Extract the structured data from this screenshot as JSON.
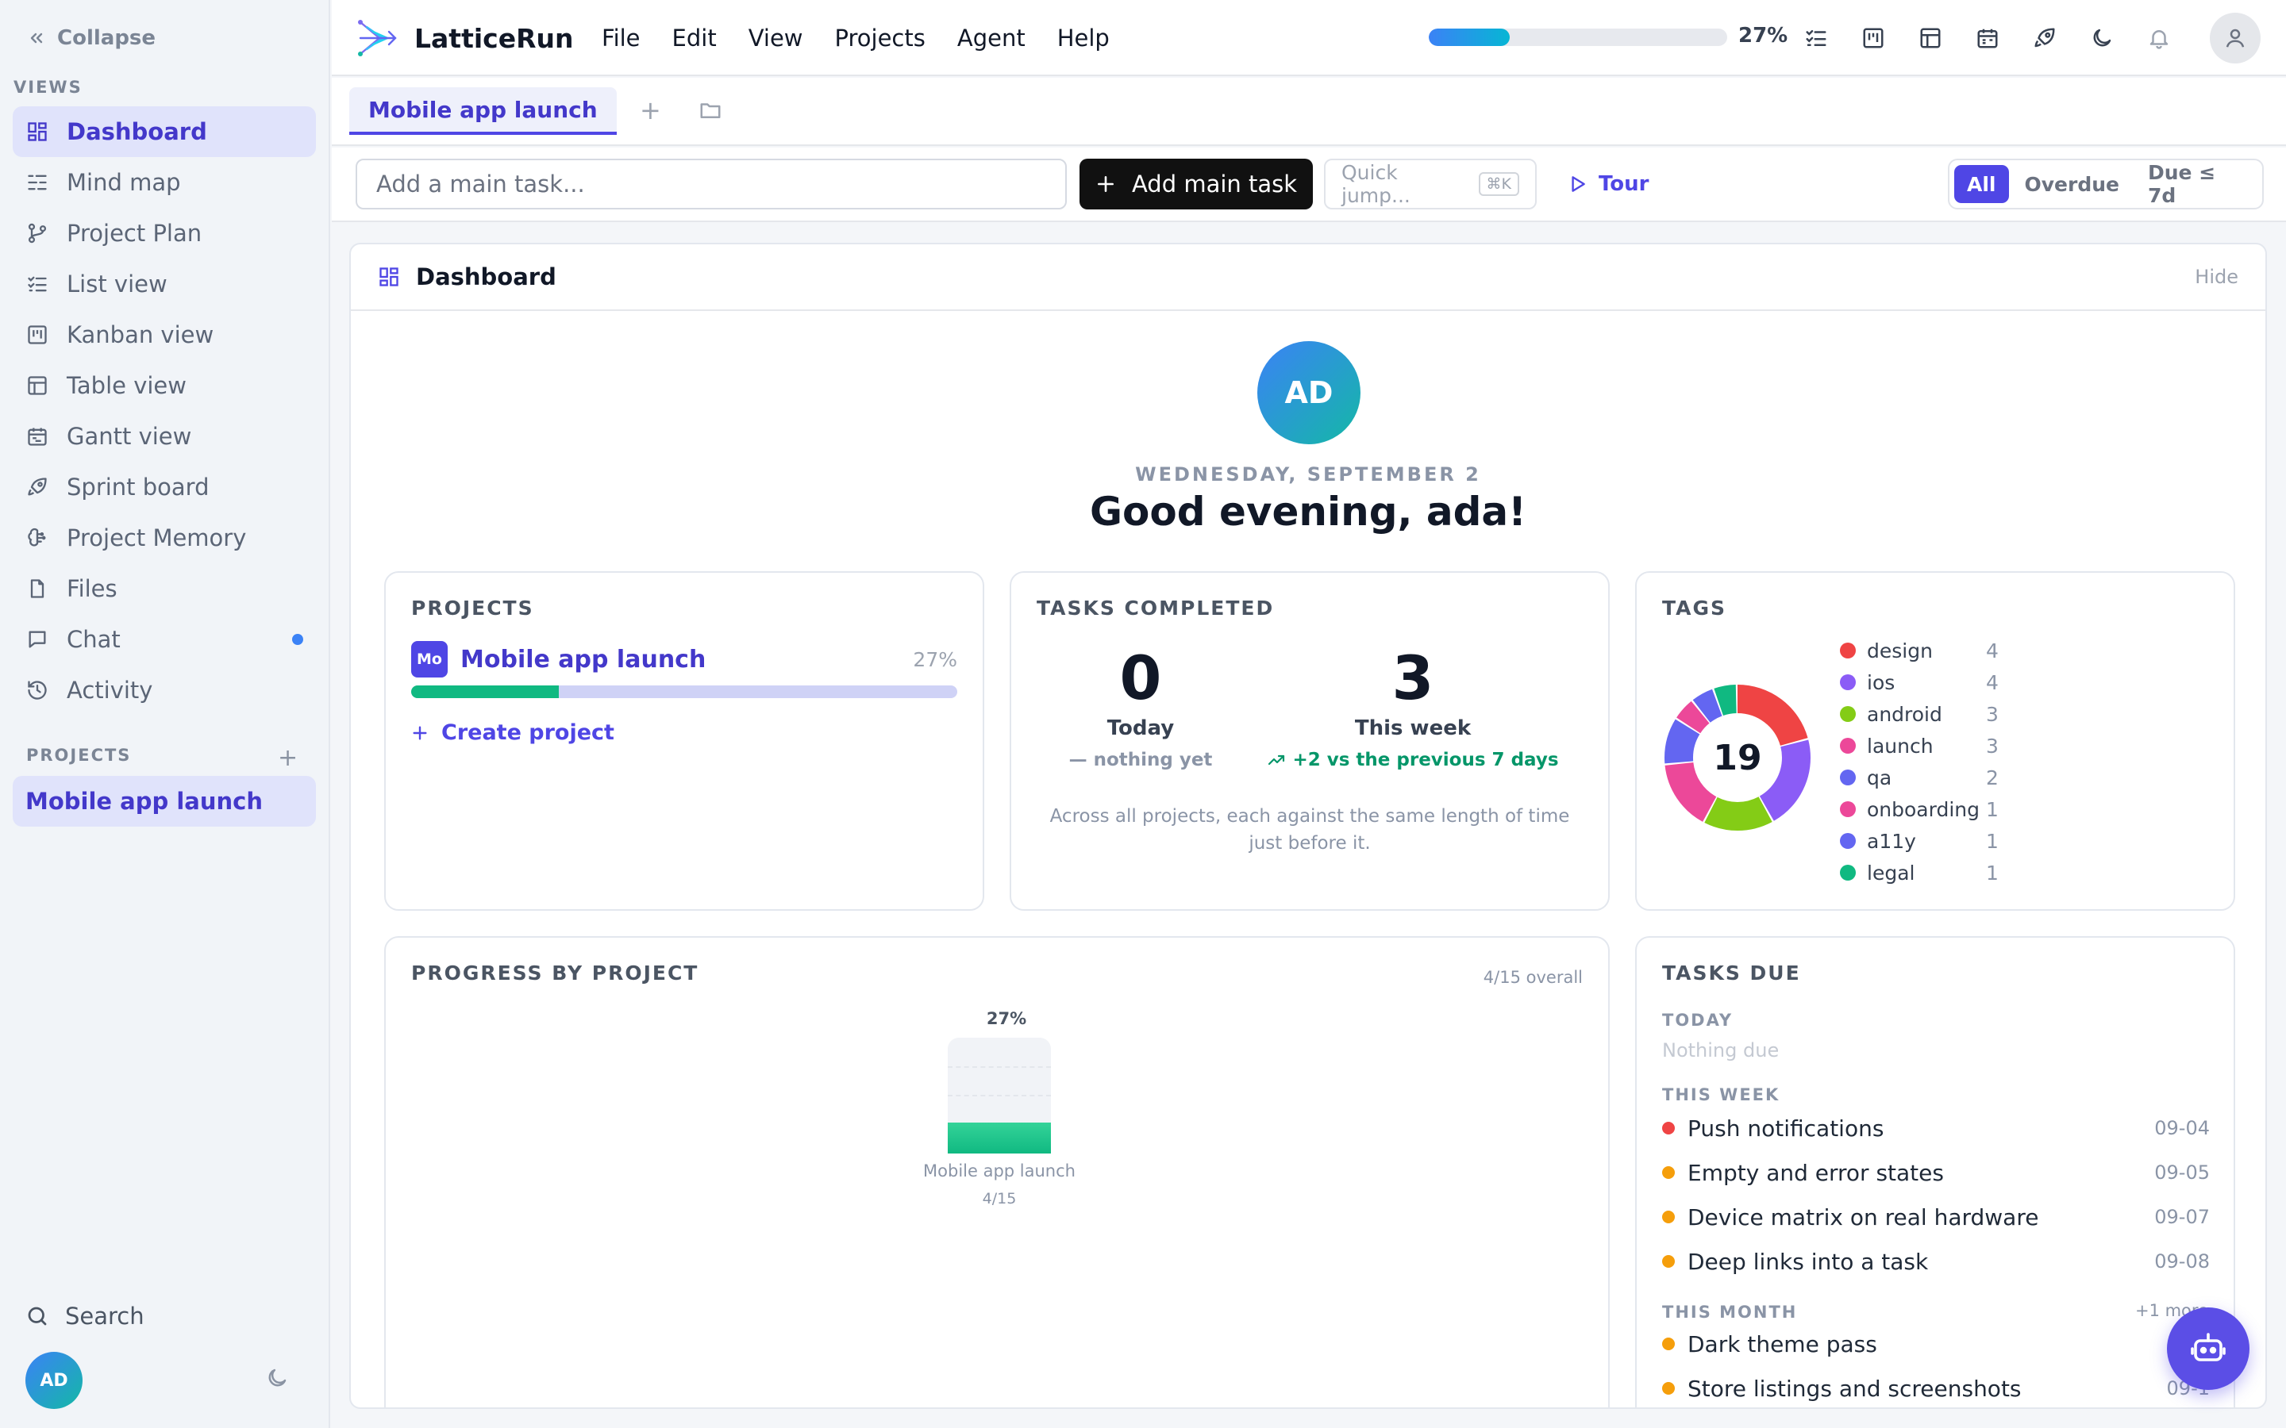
{
  "sidebar": {
    "collapse_label": "Collapse",
    "views_label": "VIEWS",
    "items": [
      {
        "label": "Dashboard",
        "icon": "dashboard-icon"
      },
      {
        "label": "Mind map",
        "icon": "mind-map-icon"
      },
      {
        "label": "Project Plan",
        "icon": "project-plan-icon"
      },
      {
        "label": "List view",
        "icon": "list-icon"
      },
      {
        "label": "Kanban view",
        "icon": "kanban-icon"
      },
      {
        "label": "Table view",
        "icon": "table-icon"
      },
      {
        "label": "Gantt view",
        "icon": "gantt-icon"
      },
      {
        "label": "Sprint board",
        "icon": "rocket-icon"
      },
      {
        "label": "Project Memory",
        "icon": "brain-icon"
      },
      {
        "label": "Files",
        "icon": "file-icon"
      },
      {
        "label": "Chat",
        "icon": "chat-icon",
        "unread": true
      },
      {
        "label": "Activity",
        "icon": "history-icon"
      }
    ],
    "projects_label": "PROJECTS",
    "projects": [
      "Mobile app launch"
    ],
    "search_label": "Search",
    "avatar_initials": "AD"
  },
  "topbar": {
    "app_name": "LatticeRun",
    "menu": [
      "File",
      "Edit",
      "View",
      "Projects",
      "Agent",
      "Help"
    ],
    "progress_pct": 27,
    "progress_label": "27%"
  },
  "tabs": {
    "active": "Mobile app launch"
  },
  "toolbar": {
    "task_placeholder": "Add a main task...",
    "add_button": "Add main task",
    "quick_jump": "Quick jump...",
    "quick_jump_kbd": "⌘K",
    "tour": "Tour",
    "filters": [
      "All",
      "Overdue",
      "Due ≤ 7d"
    ],
    "active_filter": "All"
  },
  "dashboard": {
    "title": "Dashboard",
    "hide": "Hide",
    "avatar_initials": "AD",
    "date": "WEDNESDAY, SEPTEMBER 2",
    "greeting": "Good evening, ada!",
    "projects_card": {
      "title": "PROJECTS",
      "project_badge": "Mo",
      "project_name": "Mobile app launch",
      "project_pct": "27%",
      "project_progress": 0.27,
      "create_label": "Create project"
    },
    "tasks_completed": {
      "title": "TASKS COMPLETED",
      "today_value": "0",
      "today_label": "Today",
      "today_sub": "— nothing yet",
      "week_value": "3",
      "week_label": "This week",
      "week_sub": "+2 vs the previous 7 days",
      "note": "Across all projects, each against the same length of time just before it."
    },
    "tags": {
      "title": "TAGS",
      "total": "19",
      "items": [
        {
          "name": "design",
          "count": 4,
          "color": "#ef4444"
        },
        {
          "name": "ios",
          "count": 4,
          "color": "#8b5cf6"
        },
        {
          "name": "android",
          "count": 3,
          "color": "#84cc16"
        },
        {
          "name": "launch",
          "count": 3,
          "color": "#ec4899"
        },
        {
          "name": "qa",
          "count": 2,
          "color": "#6366f1"
        },
        {
          "name": "onboarding",
          "count": 1,
          "color": "#ec4899"
        },
        {
          "name": "a11y",
          "count": 1,
          "color": "#6366f1"
        },
        {
          "name": "legal",
          "count": 1,
          "color": "#10b981"
        }
      ]
    },
    "progress_by_project": {
      "title": "PROGRESS BY PROJECT",
      "overall": "4/15 overall",
      "bar_pct": "27%",
      "bar_value": 0.27,
      "bar_label": "Mobile app launch",
      "bar_fraction": "4/15"
    },
    "tasks_due": {
      "title": "TASKS DUE",
      "today_label": "TODAY",
      "today_empty": "Nothing due",
      "week_label": "THIS WEEK",
      "week_items": [
        {
          "name": "Push notifications",
          "date": "09-04",
          "color": "#ef4444"
        },
        {
          "name": "Empty and error states",
          "date": "09-05",
          "color": "#f59e0b"
        },
        {
          "name": "Device matrix on real hardware",
          "date": "09-07",
          "color": "#f59e0b"
        },
        {
          "name": "Deep links into a task",
          "date": "09-08",
          "color": "#f59e0b"
        }
      ],
      "month_label": "THIS MONTH",
      "more": "+1 more",
      "month_items": [
        {
          "name": "Dark theme pass",
          "date": "09",
          "color": "#f59e0b"
        },
        {
          "name": "Store listings and screenshots",
          "date": "09-1",
          "color": "#f59e0b"
        }
      ]
    }
  },
  "colors": {
    "accent": "#4f46e5",
    "success": "#10b981"
  }
}
